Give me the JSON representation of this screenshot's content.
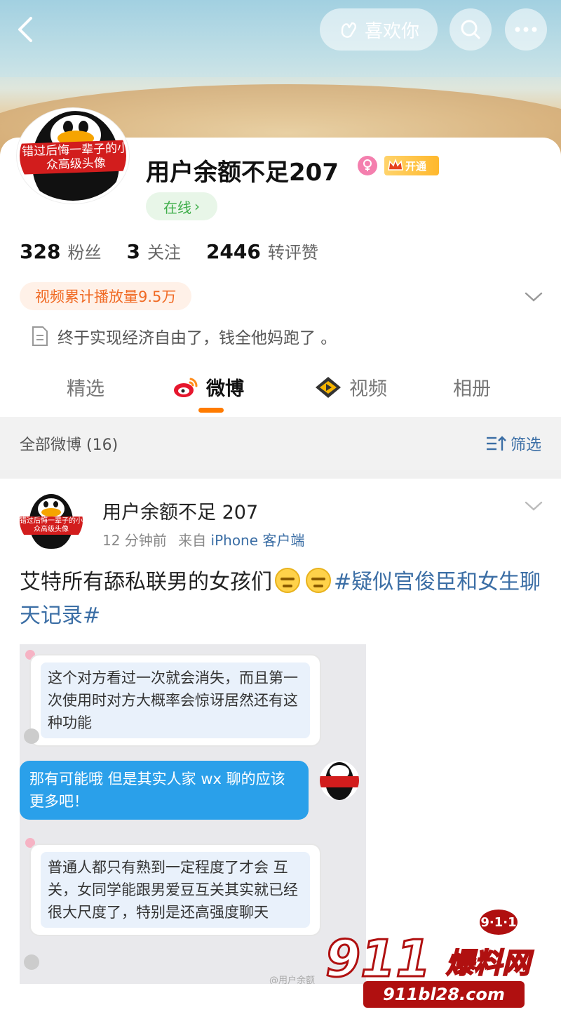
{
  "header": {
    "like_label": "喜欢你"
  },
  "profile": {
    "avatar_band": "错过后悔一辈子的小众高级头像",
    "name": "用户余额不足207",
    "vip_label": "开通",
    "online_label": "在线",
    "stats": [
      {
        "num": "328",
        "label": "粉丝"
      },
      {
        "num": "3",
        "label": "关注"
      },
      {
        "num": "2446",
        "label": "转评赞"
      }
    ],
    "play_tag": "视频累计播放量9.5万",
    "bio": "终于实现经济自由了，钱全他妈跑了 。"
  },
  "tabs": [
    {
      "label": "精选"
    },
    {
      "label": "微博"
    },
    {
      "label": "视频"
    },
    {
      "label": "相册"
    }
  ],
  "filter": {
    "all_label": "全部微博 (16)",
    "filter_label": "筛选"
  },
  "post": {
    "author": "用户余额不足 207",
    "time": "12 分钟前",
    "source_prefix": "来自",
    "source": "iPhone 客户端",
    "text_main": "艾特所有舔私联男的女孩们",
    "text_tag": "#疑似官俊臣和女生聊天记录#",
    "chat": [
      {
        "dir": "in",
        "text": "这个对方看过一次就会消失，而且第一次使用时对方大概率会惊讶居然还有这种功能"
      },
      {
        "dir": "out",
        "text": "那有可能哦 但是其实人家 wx 聊的应该更多吧！"
      },
      {
        "dir": "in",
        "text": "普通人都只有熟到一定程度了才会 互关，女同学能跟男爱豆互关其实就已经很大尺度了，特别是还高强度聊天"
      }
    ],
    "chat_watermark": "@用户余额"
  },
  "watermark": {
    "badge": "9·1·1",
    "big": "911",
    "text": "爆料网",
    "url": "911bl28.com"
  }
}
